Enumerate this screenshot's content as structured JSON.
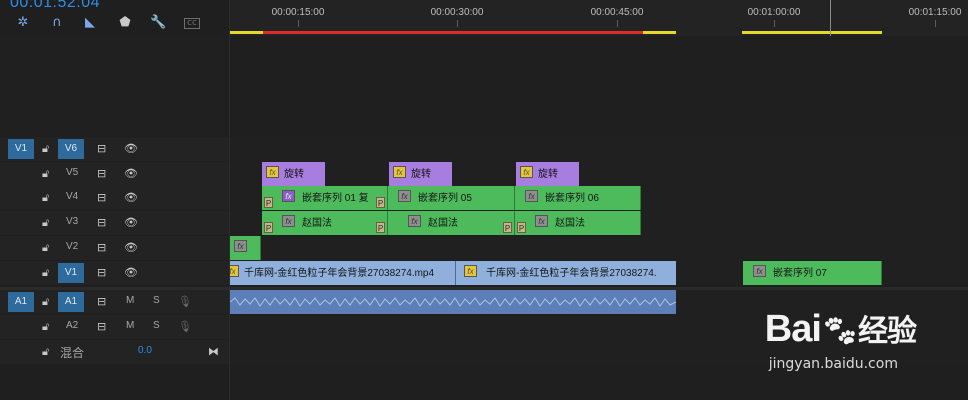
{
  "timecode": "00:01:52:04",
  "toolbar": {
    "icons": [
      "snap-icon",
      "linked-selection-icon",
      "add-marker-icon",
      "marker-icon",
      "wrench-icon",
      "captions-icon"
    ]
  },
  "ruler": {
    "labels": [
      "00:00:15:00",
      "00:00:30:00",
      "00:00:45:00",
      "00:01:00:00",
      "00:01:15:00"
    ]
  },
  "tracks": {
    "video": [
      {
        "src": "V1",
        "label": "V6"
      },
      {
        "src": "",
        "label": "V5"
      },
      {
        "src": "",
        "label": "V4"
      },
      {
        "src": "",
        "label": "V3"
      },
      {
        "src": "",
        "label": "V2"
      },
      {
        "src": "",
        "label": "V1"
      }
    ],
    "audio": [
      {
        "src": "A1",
        "label": "A1",
        "m": "M",
        "s": "S"
      },
      {
        "src": "",
        "label": "A2",
        "m": "M",
        "s": "S"
      }
    ],
    "mix": {
      "label": "混合",
      "value": "0.0"
    }
  },
  "clips": {
    "v5": [
      "旋转",
      "旋转",
      "旋转"
    ],
    "v4": [
      "嵌套序列 01 复",
      "嵌套序列 05",
      "嵌套序列 06"
    ],
    "v3": [
      "赵国法",
      "赵国法",
      "赵国法"
    ],
    "v1": [
      "千库网-金红色粒子年会背景27038274.mp4",
      "千库网-金红色粒子年会背景27038274.",
      "嵌套序列 07"
    ]
  },
  "pmark": "P",
  "fx": "fx",
  "watermark": {
    "brand": "Bai",
    "brand2": "经验",
    "url": "jingyan.baidu.com"
  },
  "colors": {
    "accent": "#2d8ceb",
    "nest": "#4dbb5c",
    "adjust": "#a77de0",
    "video": "#8fb0dc",
    "audio": "#5c7fb8",
    "render_red": "#e02b2b",
    "render_yellow": "#e5d82a"
  }
}
